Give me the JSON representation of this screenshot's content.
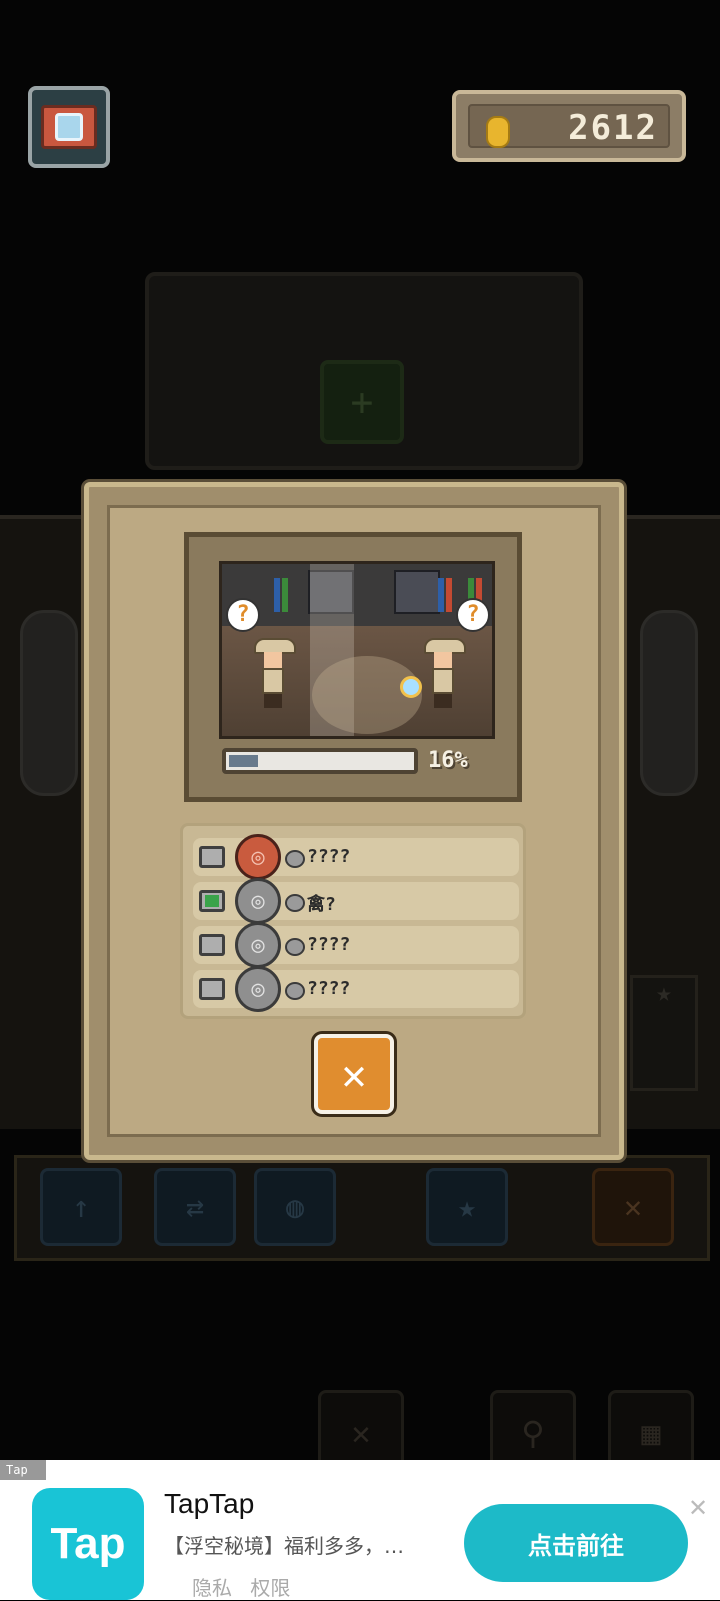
{
  "hud": {
    "camera_icon": "camera-icon",
    "coin_icon": "coin-icon",
    "coins": "2612"
  },
  "dialog": {
    "scene": {
      "question_mark": "?"
    },
    "progress": {
      "value": 0.16,
      "label": "16%"
    },
    "items": [
      {
        "checked": false,
        "fossil": "red",
        "label": "????"
      },
      {
        "checked": true,
        "fossil": "gray",
        "label": "禽?"
      },
      {
        "checked": false,
        "fossil": "gray",
        "label": "????"
      },
      {
        "checked": false,
        "fossil": "gray",
        "label": "????"
      }
    ],
    "close_label": "✕"
  },
  "background": {
    "plus": "+",
    "toolbar": [
      {
        "icon": "pickaxe-icon",
        "glyph": "↑"
      },
      {
        "icon": "swap-icon",
        "glyph": "⇄"
      },
      {
        "icon": "globe-icon",
        "glyph": "◍"
      },
      {
        "icon": "star-icon",
        "glyph": "★"
      },
      {
        "icon": "close-icon",
        "glyph": "✕"
      }
    ],
    "bottom_buttons": [
      {
        "icon": "close-icon",
        "glyph": "✕"
      },
      {
        "icon": "search-icon",
        "glyph": "⚲"
      },
      {
        "icon": "map-icon",
        "glyph": "▦"
      }
    ],
    "side_star": "★"
  },
  "ad": {
    "tag": "Tap",
    "logo_text": "Tap",
    "title": "TapTap",
    "description": "【浮空秘境】福利多多，…",
    "links": [
      "隐私",
      "权限"
    ],
    "cta": "点击前往",
    "close": "✕"
  },
  "colors": {
    "accent_orange": "#e08d2f",
    "panel": "#bca983",
    "ad_cta": "#1dbac8"
  }
}
